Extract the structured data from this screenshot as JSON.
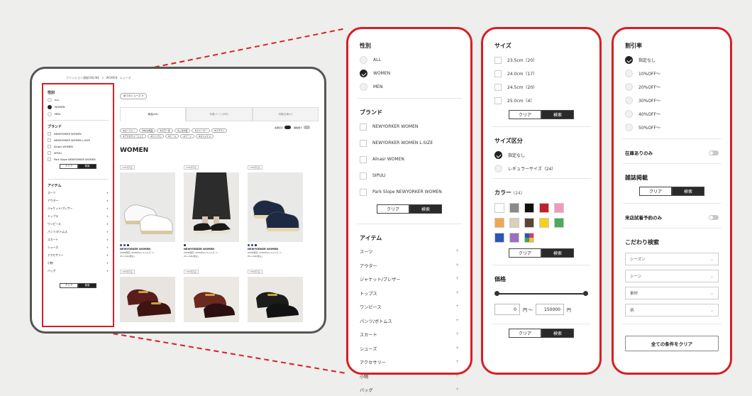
{
  "thumb": {
    "breadcrumb": [
      "ファッション通販ONLINE",
      ">",
      "WOMEN",
      "シューズ"
    ],
    "sidebar": {
      "gender_title": "性別",
      "gender": [
        {
          "label": "ALL",
          "on": false
        },
        {
          "label": "WOMEN",
          "on": true
        },
        {
          "label": "MEN",
          "on": false
        }
      ],
      "brand_title": "ブランド",
      "brands": [
        "NEWYORKER WOMEN",
        "NEWYORKER WOMEN L-SIZE",
        "Alnasr WOMEN",
        "SIPULI",
        "Park Slope NEWYORKER WOMEN"
      ],
      "clear": "クリア",
      "search": "検索",
      "item_title": "アイテム",
      "items": [
        "スーツ",
        "アウター",
        "ジャケット/ブレザー",
        "トップス",
        "ワンピース",
        "パンツ/ボトムス",
        "スカート",
        "シューズ",
        "アクセサリー",
        "小物",
        "バッグ"
      ],
      "plus": "+"
    },
    "chip": "全てのシューズ ×",
    "tabs": [
      "商品(24)",
      "特集ページ(0件)",
      "特集記事(0)"
    ],
    "tags": [
      "#ローファー",
      "#New商品",
      "#カラー系",
      "#こなれ感",
      "#スニーカー",
      "#ブラウン",
      "#アクセサリーとして",
      "#パンプス",
      "#ヒール",
      "#ブーツ",
      "#オリジナル"
    ],
    "toggle_a": "在庫表示",
    "toggle_b": "価格順で",
    "heading": "WOMEN",
    "products": [
      {
        "badge": "WEB限定品",
        "brand": "NEWYORKER WOMEN",
        "desc": "[WEB限定] SUPERGA/スペルガ ス...",
        "price": "¥11,000(税込)"
      },
      {
        "badge": "WEB限定品",
        "brand": "NEWYORKER WOMEN",
        "desc": "[WEB限定] SUPERGA/スペルガ ス...",
        "price": "¥11,000(税込)"
      },
      {
        "badge": "WEB限定品",
        "brand": "NEWYORKER WOMEN",
        "desc": "[WEB限定] SUPERGA/スペルガ ス...",
        "price": "¥11,000(税込)"
      }
    ],
    "badges2": [
      "WEB限定品",
      "WEB限定品",
      "WEB限定品"
    ]
  },
  "panel1": {
    "gender_title": "性別",
    "gender": [
      {
        "label": "ALL",
        "on": false
      },
      {
        "label": "WOMEN",
        "on": true
      },
      {
        "label": "MEN",
        "on": false
      }
    ],
    "brand_title": "ブランド",
    "brands": [
      "NEWYORKER WOMEN",
      "NEWYORKER WOMEN L-SIZE",
      "Alnasr WOMEN",
      "SIPULI",
      "Park Slope NEWYORKER WOMEN"
    ],
    "clear": "クリア",
    "search": "検索",
    "item_title": "アイテム",
    "items": [
      "スーツ",
      "アウター",
      "ジャケット/ブレザー",
      "トップス",
      "ワンピース",
      "パンツ/ボトムス",
      "スカート",
      "シューズ",
      "アクセサリー",
      "小物",
      "バッグ"
    ],
    "plus": "+"
  },
  "panel2": {
    "size_title": "サイズ",
    "sizes": [
      "23.5cm（20）",
      "24.0cm（17）",
      "24.5cm（20）",
      "25.0cm（4）"
    ],
    "size_class_title": "サイズ区分",
    "size_classes": [
      {
        "label": "指定なし",
        "on": true
      },
      {
        "label": "レギュラーサイズ（24）",
        "on": false
      }
    ],
    "color_title": "カラー",
    "color_count": "(24)",
    "colors": [
      "#ffffff",
      "#8a8a8a",
      "#111111",
      "#c0202a",
      "#f19ac0",
      "#f0a852",
      "#d8d0b8",
      "#5a4634",
      "#f2d21e",
      "#4caa5a",
      "#2a56b5",
      "#9a6fc0",
      "multi"
    ],
    "price_title": "価格",
    "price_min": "0",
    "price_unit_min": "円 〜",
    "price_max": "150000",
    "price_unit_max": "円",
    "clear": "クリア",
    "search": "検索"
  },
  "panel3": {
    "discount_title": "割引率",
    "discounts": [
      {
        "label": "指定なし",
        "on": true
      },
      {
        "label": "10%OFF〜",
        "on": false
      },
      {
        "label": "20%OFF〜",
        "on": false
      },
      {
        "label": "30%OFF〜",
        "on": false
      },
      {
        "label": "40%OFF〜",
        "on": false
      },
      {
        "label": "50%OFF〜",
        "on": false
      }
    ],
    "stock_label": "在庫ありのみ",
    "magazine_title": "雑誌掲載",
    "clear": "クリア",
    "search": "検索",
    "reserve_label": "来店試着予約のみ",
    "detail_title": "こだわり検索",
    "selects": [
      "シーズン",
      "シーン",
      "素材",
      "柄"
    ],
    "clear_all": "全ての条件をクリア"
  }
}
